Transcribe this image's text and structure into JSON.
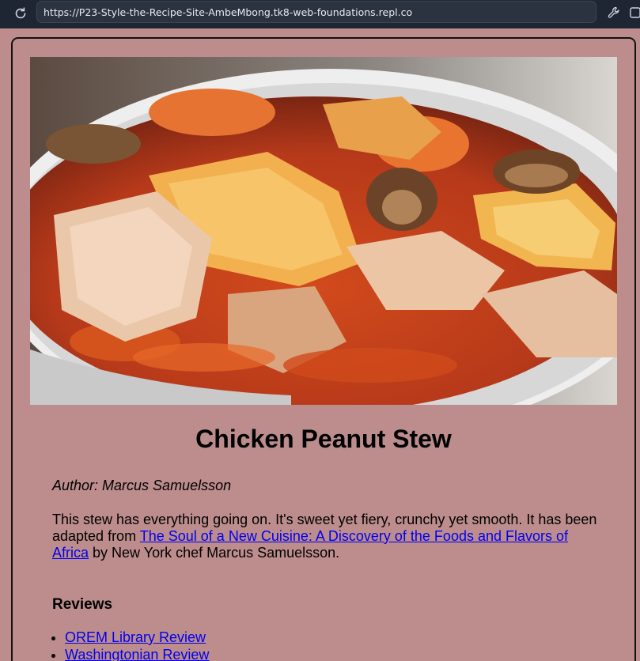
{
  "browser": {
    "url": "https://P23-Style-the-Recipe-Site-AmbeMbong.tk8-web-foundations.repl.co",
    "icons": [
      "reload-icon",
      "wrench-icon",
      "new-tab-icon"
    ]
  },
  "page": {
    "background_color": "#bd8d8d",
    "hero_image_alt": "Bowl of chicken peanut stew",
    "title": "Chicken Peanut Stew",
    "author": "Author: Marcus Samuelsson",
    "description_before": "This stew has everything going on. It's sweet yet fiery, crunchy yet smooth. It has been adapted from ",
    "description_link": "The Soul of a New Cuisine: A Discovery of the Foods and Flavors of Africa",
    "description_after": " by New York chef Marcus Samuelsson.",
    "reviews_heading": "Reviews",
    "reviews": [
      {
        "label": "OREM Library Review"
      },
      {
        "label": "Washingtonian Review"
      }
    ],
    "link_color": "#0000ee"
  }
}
